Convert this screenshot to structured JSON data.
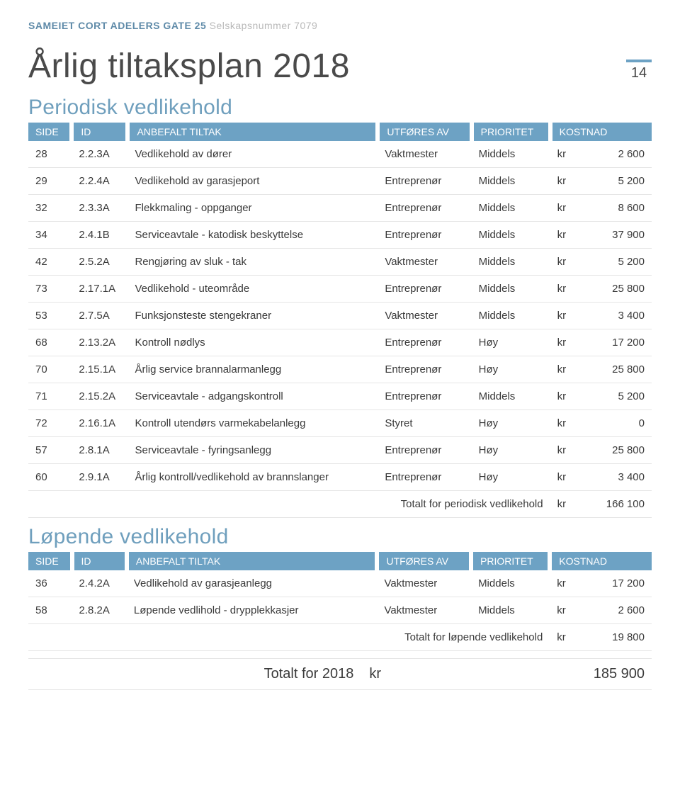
{
  "header": {
    "org_name": "SAMEIET CORT ADELERS GATE 25",
    "org_sub": "Selskapsnummer 7079"
  },
  "page_title": "Årlig tiltaksplan 2018",
  "page_number": "14",
  "columns": {
    "side": "SIDE",
    "id": "ID",
    "task": "ANBEFALT TILTAK",
    "by": "UTFØRES AV",
    "prio": "PRIORITET",
    "cost": "KOSTNAD"
  },
  "currency": "kr",
  "sections": [
    {
      "title": "Periodisk vedlikehold",
      "rows": [
        {
          "side": "28",
          "id": "2.2.3A",
          "task": "Vedlikehold av dører",
          "by": "Vaktmester",
          "prio": "Middels",
          "cost": "2 600"
        },
        {
          "side": "29",
          "id": "2.2.4A",
          "task": "Vedlikehold av garasjeport",
          "by": "Entreprenør",
          "prio": "Middels",
          "cost": "5 200"
        },
        {
          "side": "32",
          "id": "2.3.3A",
          "task": "Flekkmaling - oppganger",
          "by": "Entreprenør",
          "prio": "Middels",
          "cost": "8 600"
        },
        {
          "side": "34",
          "id": "2.4.1B",
          "task": "Serviceavtale - katodisk beskyttelse",
          "by": "Entreprenør",
          "prio": "Middels",
          "cost": "37 900"
        },
        {
          "side": "42",
          "id": "2.5.2A",
          "task": "Rengjøring av sluk - tak",
          "by": "Vaktmester",
          "prio": "Middels",
          "cost": "5 200"
        },
        {
          "side": "73",
          "id": "2.17.1A",
          "task": "Vedlikehold - uteområde",
          "by": "Entreprenør",
          "prio": "Middels",
          "cost": "25 800"
        },
        {
          "side": "53",
          "id": "2.7.5A",
          "task": "Funksjonsteste stengekraner",
          "by": "Vaktmester",
          "prio": "Middels",
          "cost": "3 400"
        },
        {
          "side": "68",
          "id": "2.13.2A",
          "task": "Kontroll nødlys",
          "by": "Entreprenør",
          "prio": "Høy",
          "cost": "17 200"
        },
        {
          "side": "70",
          "id": "2.15.1A",
          "task": "Årlig service brannalarmanlegg",
          "by": "Entreprenør",
          "prio": "Høy",
          "cost": "25 800"
        },
        {
          "side": "71",
          "id": "2.15.2A",
          "task": "Serviceavtale - adgangskontroll",
          "by": "Entreprenør",
          "prio": "Middels",
          "cost": "5 200"
        },
        {
          "side": "72",
          "id": "2.16.1A",
          "task": "Kontroll utendørs varmekabelanlegg",
          "by": "Styret",
          "prio": "Høy",
          "cost": "0"
        },
        {
          "side": "57",
          "id": "2.8.1A",
          "task": "Serviceavtale - fyringsanlegg",
          "by": "Entreprenør",
          "prio": "Høy",
          "cost": "25 800"
        },
        {
          "side": "60",
          "id": "2.9.1A",
          "task": "Årlig kontroll/vedlikehold av brannslanger",
          "by": "Entreprenør",
          "prio": "Høy",
          "cost": "3 400"
        }
      ],
      "subtotal_label": "Totalt for periodisk vedlikehold",
      "subtotal_cost": "166 100"
    },
    {
      "title": "Løpende vedlikehold",
      "rows": [
        {
          "side": "36",
          "id": "2.4.2A",
          "task": "Vedlikehold av garasjeanlegg",
          "by": "Vaktmester",
          "prio": "Middels",
          "cost": "17 200"
        },
        {
          "side": "58",
          "id": "2.8.2A",
          "task": "Løpende vedlihold - drypplekkasjer",
          "by": "Vaktmester",
          "prio": "Middels",
          "cost": "2 600"
        }
      ],
      "subtotal_label": "Totalt for løpende vedlikehold",
      "subtotal_cost": "19 800"
    }
  ],
  "grand_total": {
    "label": "Totalt for 2018",
    "cost": "185 900"
  }
}
